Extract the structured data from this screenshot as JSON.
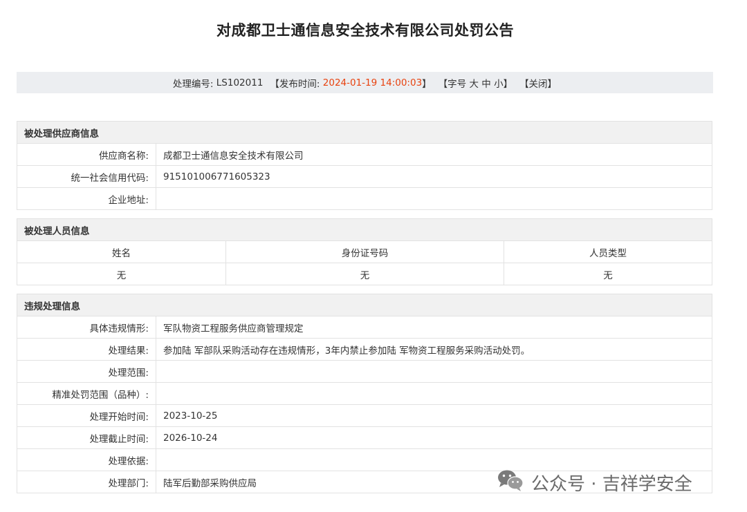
{
  "title": "对成都卫士通信息安全技术有限公司处罚公告",
  "meta": {
    "number_label": "处理编号:",
    "number_value": "LS102011",
    "publish_open": "【发布时间:",
    "publish_value": "2024-01-19 14:00:03",
    "publish_close": "】",
    "font_open": "【字号",
    "font_large": "大",
    "font_medium": "中",
    "font_small": "小",
    "font_close": "】",
    "close_label": "【关闭】",
    "highlight_color": "#e8420f"
  },
  "supplier": {
    "heading": "被处理供应商信息",
    "rows": [
      {
        "label": "供应商名称:",
        "value": "成都卫士通信息安全技术有限公司"
      },
      {
        "label": "统一社会信用代码:",
        "value": "915101006771605323"
      },
      {
        "label": "企业地址:",
        "value": ""
      }
    ]
  },
  "personnel": {
    "heading": "被处理人员信息",
    "columns": [
      "姓名",
      "身份证号码",
      "人员类型"
    ],
    "row": [
      "无",
      "无",
      "无"
    ]
  },
  "violation": {
    "heading": "违规处理信息",
    "rows": [
      {
        "label": "具体违规情形:",
        "value": "军队物资工程服务供应商管理规定"
      },
      {
        "label": "处理结果:",
        "value": "参加陆 军部队采购活动存在违规情形，3年内禁止参加陆 军物资工程服务采购活动处罚。"
      },
      {
        "label": "处理范围:",
        "value": ""
      },
      {
        "label": "精准处罚范围（品种）:",
        "value": ""
      },
      {
        "label": "处理开始时间:",
        "value": "2023-10-25"
      },
      {
        "label": "处理截止时间:",
        "value": "2026-10-24"
      },
      {
        "label": "处理依据:",
        "value": ""
      },
      {
        "label": "处理部门:",
        "value": "陆军后勤部采购供应局"
      }
    ]
  },
  "watermark": {
    "text": "公众号 · 吉祥学安全",
    "icon": "wechat-icon"
  }
}
